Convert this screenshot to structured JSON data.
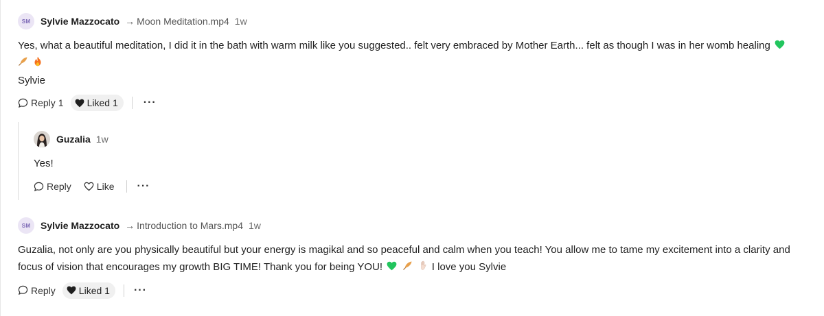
{
  "comments": [
    {
      "avatar_initials": "SM",
      "author": "Sylvie Mazzocato",
      "arrow": "→",
      "target": "Moon Meditation.mp4",
      "time": "1w",
      "text_line1": "Yes, what a beautiful meditation, I did it in the bath with warm milk like you suggested.. felt very embraced by Mother Earth... felt as though I was in her womb healing",
      "text_line2": "Sylvie",
      "reply_label": "Reply",
      "reply_count": "1",
      "liked_label": "Liked 1",
      "more": "···"
    },
    {
      "avatar_initials": "SM",
      "author": "Sylvie Mazzocato",
      "arrow": "→",
      "target": "Introduction to Mars.mp4",
      "time": "1w",
      "text_part1": "Guzalia, not only are you physically beautiful but your energy is magikal and so peaceful and calm when you teach! You allow me to tame my excitement into a clarity and focus of vision that encourages my growth BIG TIME! Thank you for being YOU!",
      "text_part2": "I love you Sylvie",
      "reply_label": "Reply",
      "liked_label": "Liked 1",
      "more": "···"
    }
  ],
  "reply": {
    "author": "Guzalia",
    "time": "1w",
    "text": "Yes!",
    "reply_label": "Reply",
    "like_label": "Like",
    "more": "···"
  },
  "icons": {
    "heart_emoji": "green-heart-icon",
    "feather_emoji": "feather-icon",
    "fire_emoji": "fire-icon",
    "hand_emoji": "raised-hand-icon",
    "comment_icon": "speech-bubble-icon",
    "liked_icon": "filled-heart-icon",
    "like_icon": "outline-heart-icon"
  },
  "colors": {
    "green_heart": "#22c55e",
    "avatar_bg": "#ebe5f5",
    "avatar_text": "#7b67b5",
    "liked_pill_bg": "#f0f0f0"
  }
}
